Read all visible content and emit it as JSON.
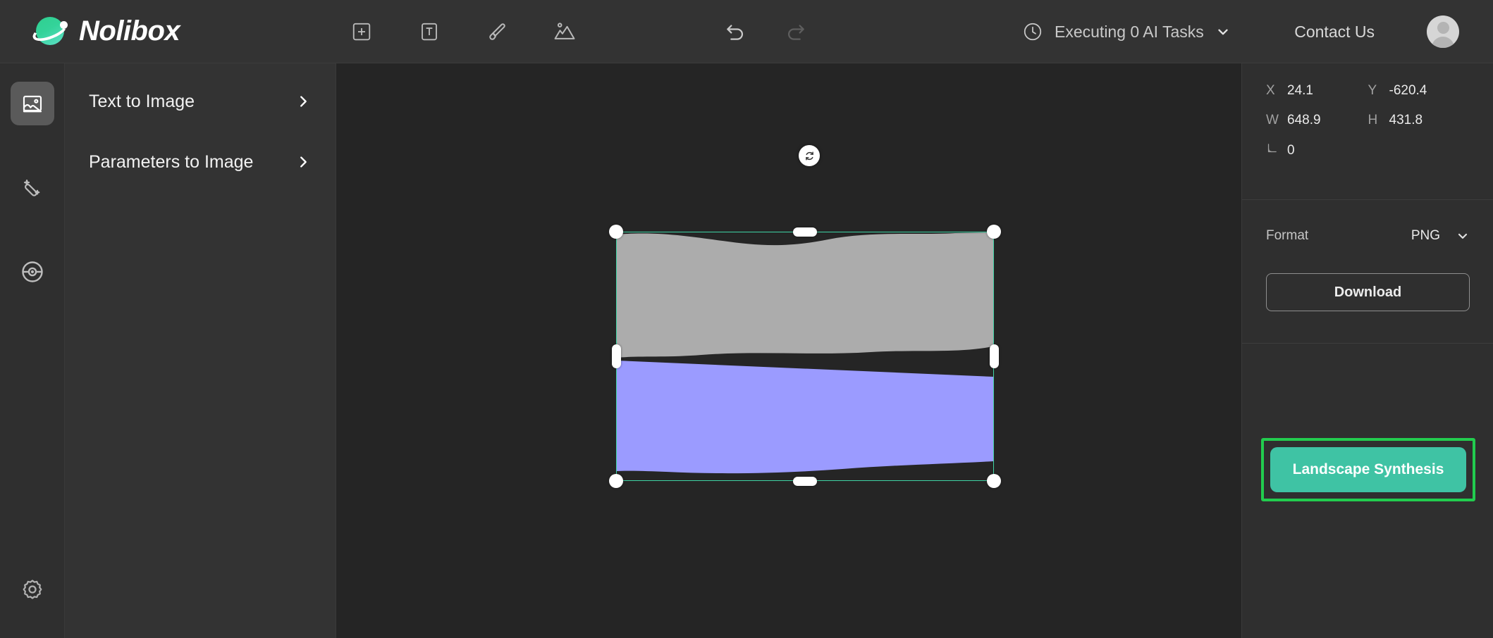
{
  "header": {
    "brand_name": "Nolibox",
    "logo_icon": "planet-logo-icon",
    "tools": [
      {
        "name": "add-frame-button",
        "icon": "plus-square-icon"
      },
      {
        "name": "add-text-button",
        "icon": "text-square-icon"
      },
      {
        "name": "brush-button",
        "icon": "brush-icon"
      },
      {
        "name": "add-image-button",
        "icon": "image-mountains-icon"
      }
    ],
    "history": [
      {
        "name": "undo-button",
        "icon": "undo-arrow-icon",
        "enabled": true
      },
      {
        "name": "redo-button",
        "icon": "redo-arrow-icon",
        "enabled": false
      }
    ],
    "ai_status": {
      "icon": "clock-icon",
      "text": "Executing 0 AI Tasks",
      "chevron": "chevron-down-icon"
    },
    "contact_label": "Contact Us",
    "avatar_icon": "user-avatar-icon"
  },
  "rail": {
    "items": [
      {
        "name": "rail-item-image",
        "icon": "image-icon",
        "active": true
      },
      {
        "name": "rail-item-magic-wand",
        "icon": "magic-wand-icon",
        "active": false
      },
      {
        "name": "rail-item-circle-tool",
        "icon": "circle-target-icon",
        "active": false
      }
    ],
    "settings": {
      "name": "rail-item-settings",
      "icon": "gear-icon"
    }
  },
  "panel": {
    "items": [
      {
        "label": "Text to Image",
        "chevron": "chevron-right-icon"
      },
      {
        "label": "Parameters to Image",
        "chevron": "chevron-right-icon"
      }
    ]
  },
  "canvas": {
    "selection": {
      "rotate_icon": "rotate-handle-icon",
      "border_color": "#3fd4a5",
      "handle_color": "#ffffff"
    },
    "artwork": {
      "background_color": "#252525",
      "sky_color": "#ACACAC",
      "water_color": "#9B9BFF"
    }
  },
  "properties": {
    "rows": [
      [
        {
          "key": "X",
          "value": "24.1"
        },
        {
          "key": "Y",
          "value": "-620.4"
        }
      ],
      [
        {
          "key": "W",
          "value": "648.9"
        },
        {
          "key": "H",
          "value": "431.8"
        }
      ]
    ],
    "rotation": {
      "icon": "angle-icon",
      "value": "0"
    }
  },
  "export": {
    "format_label": "Format",
    "format_value": "PNG",
    "format_chevron": "chevron-down-icon",
    "download_label": "Download"
  },
  "actions": {
    "synthesis_label": "Landscape Synthesis",
    "synthesis_color": "#3fc3a4",
    "highlight_color": "#22cc4e"
  }
}
